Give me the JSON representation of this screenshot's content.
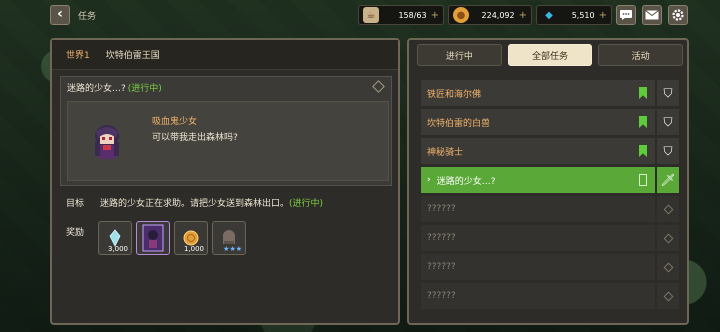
{
  "header": {
    "title": "任务",
    "stamina": "158/63",
    "gold": "224,092",
    "gems": "5,510"
  },
  "left": {
    "world_label": "世界1",
    "world_name": "坎特伯雷王国",
    "quest": {
      "title": "迷路的少女…?",
      "status": "(进行中)",
      "npc_name": "吸血鬼少女",
      "npc_line": "可以带我走出森林吗?"
    },
    "goal_label": "目标",
    "goal_text": "迷路的少女正在求助。请把少女送到森林出口。",
    "goal_status": "(进行中)",
    "reward_label": "奖励",
    "rewards": [
      {
        "icon": "crystal-icon",
        "qty": "3,000"
      },
      {
        "icon": "hero-card-icon",
        "qty": ""
      },
      {
        "icon": "gold-coin-icon",
        "qty": "1,000"
      },
      {
        "icon": "equipment-icon",
        "qty": ""
      }
    ]
  },
  "right": {
    "tabs": [
      {
        "label": "进行中",
        "active": false
      },
      {
        "label": "全部任务",
        "active": true
      },
      {
        "label": "活动",
        "active": false
      }
    ],
    "quests": [
      {
        "label": "铁匠和海尔佛",
        "state": "done"
      },
      {
        "label": "坎特伯雷的白兽",
        "state": "done"
      },
      {
        "label": "神秘骑士",
        "state": "done"
      },
      {
        "label": "迷路的少女…?",
        "state": "active"
      },
      {
        "label": "??????",
        "state": "locked"
      },
      {
        "label": "??????",
        "state": "locked"
      },
      {
        "label": "??????",
        "state": "locked"
      },
      {
        "label": "??????",
        "state": "locked"
      }
    ]
  },
  "colors": {
    "accent_green": "#5aa838",
    "gold_text": "#f2b36b",
    "progress_green": "#7cd141"
  }
}
